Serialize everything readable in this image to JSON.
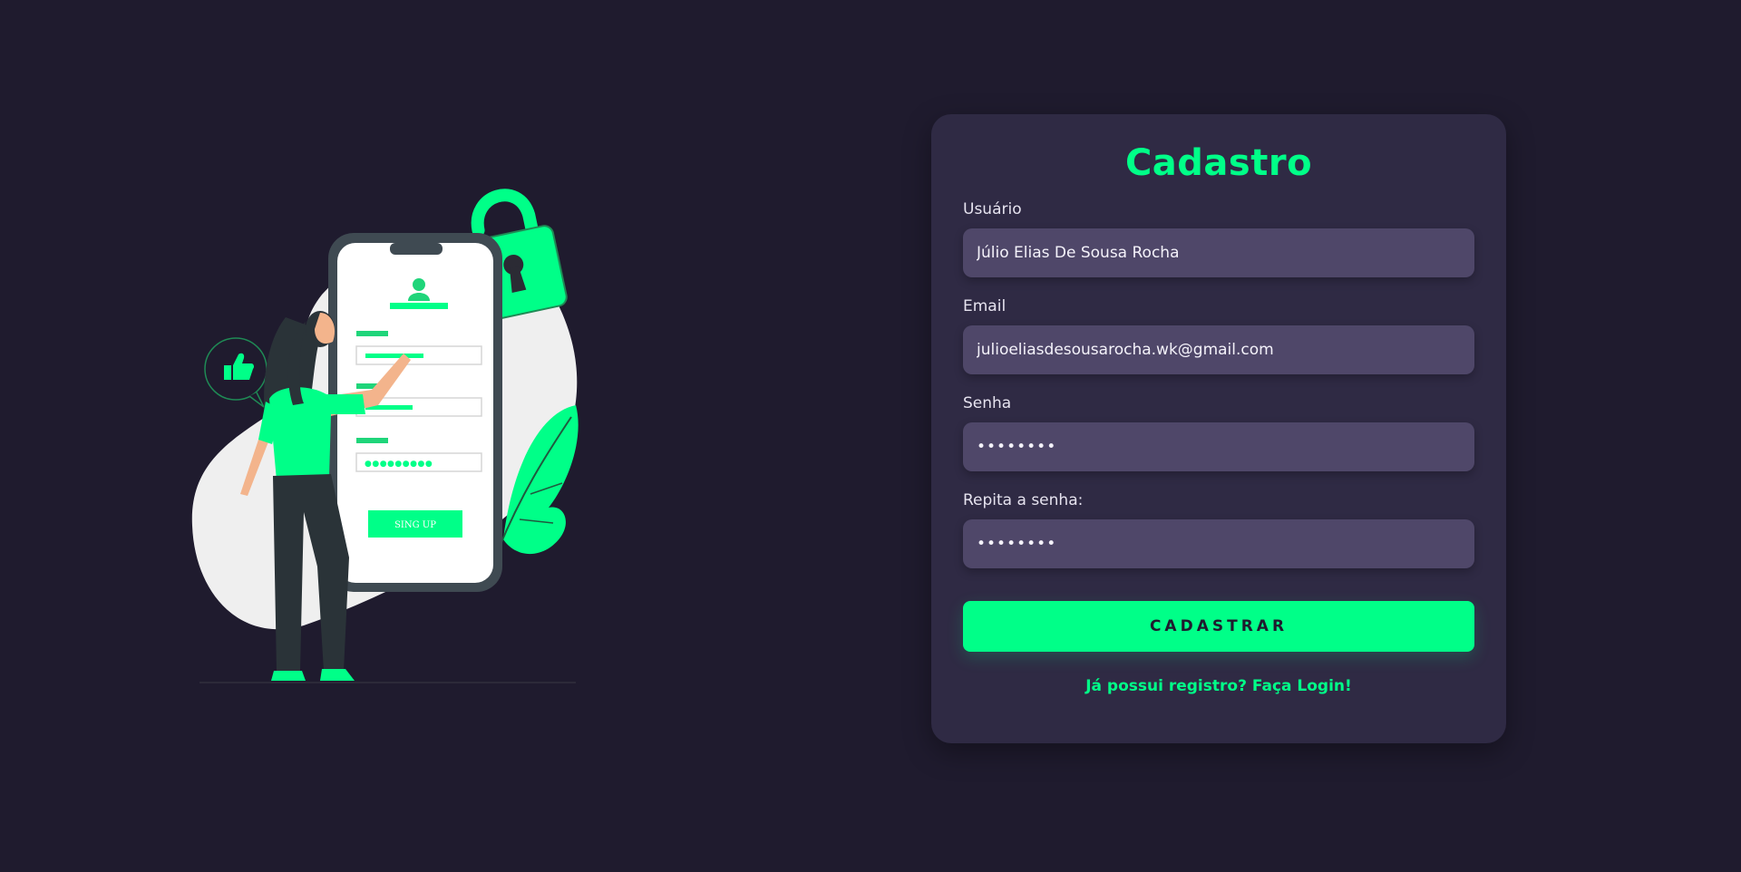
{
  "form": {
    "title": "Cadastro",
    "fields": [
      {
        "label": "Usuário",
        "value": "Júlio Elias De Sousa Rocha",
        "type": "text"
      },
      {
        "label": "Email",
        "value": "julioeliasdesousarocha.wk@gmail.com",
        "type": "email"
      },
      {
        "label": "Senha",
        "value": "••••••••",
        "type": "password"
      },
      {
        "label": "Repita a senha:",
        "value": "••••••••",
        "type": "password"
      }
    ],
    "submit_label": "CADASTRAR",
    "login_link": "Já possui registro? Faça Login!"
  },
  "illustration": {
    "signup_button_label": "SING UP",
    "password_dots": "●●●●●●●●●"
  },
  "colors": {
    "accent": "#00ff88",
    "background": "#1f1b2e",
    "card": "#2f2a44",
    "input": "#4f4769"
  }
}
